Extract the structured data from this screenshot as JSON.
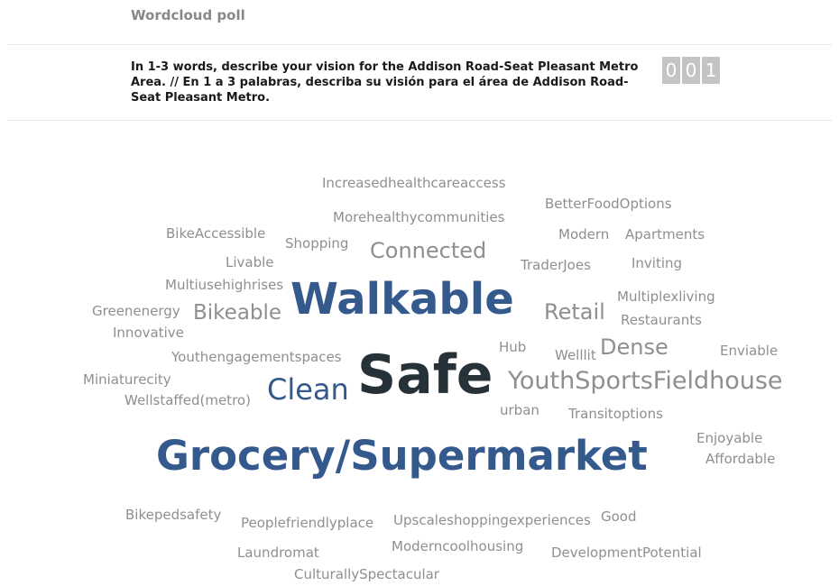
{
  "header": {
    "title": "Wordcloud poll"
  },
  "question": {
    "text": "In 1-3 words, describe your vision for the Addison Road-Seat Pleasant Metro Area. // En 1 a 3 palabras, describa su visión para el área de Addison Road-Seat Pleasant Metro."
  },
  "counter": {
    "digits": [
      "0",
      "0",
      "1"
    ]
  },
  "words": {
    "increasedhealthcareaccess": "Increasedhealthcareaccess",
    "betterfoodoptions": "BetterFoodOptions",
    "morehealthycommunities": "Morehealthycommunities",
    "bikeaccessible": "BikeAccessible",
    "shopping": "Shopping",
    "connected": "Connected",
    "modern": "Modern",
    "apartments": "Apartments",
    "livable": "Livable",
    "traderjoes": "TraderJoes",
    "inviting": "Inviting",
    "multiusehighrises": "Multiusehighrises",
    "walkable": "Walkable",
    "multiplexliving": "Multiplexliving",
    "greenenergy": "Greenenergy",
    "bikeable": "Bikeable",
    "retail": "Retail",
    "restaurants": "Restaurants",
    "innovative": "Innovative",
    "hub": "Hub",
    "welllit": "Welllit",
    "dense": "Dense",
    "enviable": "Enviable",
    "youthengagementspaces": "Youthengagementspaces",
    "miniaturecity": "Miniaturecity",
    "safe": "Safe",
    "youthsportsfieldhouse": "YouthSportsFieldhouse",
    "clean": "Clean",
    "wellstaffed": "Wellstaffed(metro)",
    "urban": "urban",
    "transitoptions": "Transitoptions",
    "enjoyable": "Enjoyable",
    "grocery": "Grocery/Supermarket",
    "affordable": "Affordable",
    "bikepedsafety": "Bikepedsafety",
    "peoplefriendlyplace": "Peoplefriendlyplace",
    "upscaleshopping": "Upscaleshoppingexperiences",
    "good": "Good",
    "laundromat": "Laundromat",
    "moderncoolhousing": "Moderncoolhousing",
    "developmentpotential": "DevelopmentPotential",
    "culturallyspectacular": "CulturallySpectacular"
  },
  "colors": {
    "accent": "#34598c",
    "emphasis": "#263238",
    "muted": "#8f8f8f"
  }
}
